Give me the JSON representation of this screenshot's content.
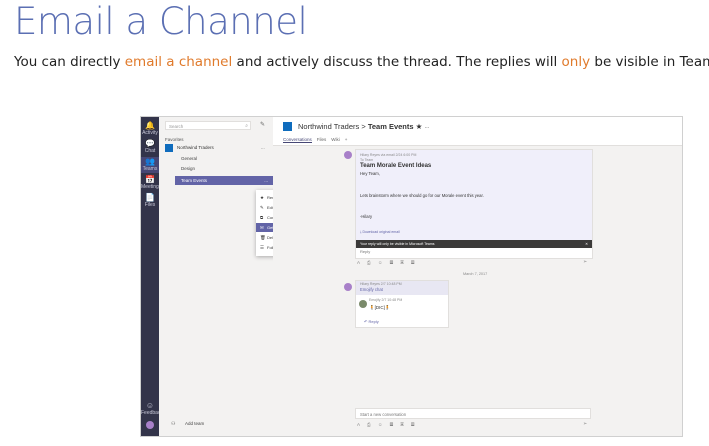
{
  "slide": {
    "title": "Email a Channel",
    "subtitle_before": "You can directly ",
    "subtitle_hl1": "email a channel",
    "subtitle_mid": " and actively discuss the thread. The replies will ",
    "subtitle_hl2": "only",
    "subtitle_after": " be visible in Teams."
  },
  "rail": {
    "items": [
      {
        "icon": "🔔",
        "label": "Activity"
      },
      {
        "icon": "💬",
        "label": "Chat"
      },
      {
        "icon": "👥",
        "label": "Teams"
      },
      {
        "icon": "📅",
        "label": "Meetings"
      },
      {
        "icon": "📄",
        "label": "Files"
      }
    ],
    "feedback": "Feedback"
  },
  "teams_panel": {
    "search_placeholder": "Search",
    "favorites_label": "Favorites",
    "team_name": "Northwind Traders",
    "team_menu": "...",
    "channels": [
      "General",
      "Design",
      "Team Events"
    ],
    "selected_menu": "...",
    "add_team": "Add team"
  },
  "context_menu": {
    "items": [
      "Remove favorite",
      "Edit this channel",
      "Connectors",
      "Get email address",
      "Delete this channel",
      "Follow this channel"
    ]
  },
  "header": {
    "team": "Northwind Traders",
    "separator": " > ",
    "channel": "Team Events",
    "star": "★",
    "more": "···",
    "tabs": [
      "Conversations",
      "Files",
      "Wiki",
      "+"
    ]
  },
  "post": {
    "meta": "Hilary Reyes via email  2/24 6:00 PM",
    "meta2": "To Team",
    "subject": "Team Morale Event Ideas",
    "greeting": "Hey Team,",
    "body": "Lets brainstorm where we should go for our Morale event this year.",
    "signature": "-Hilary",
    "download": "Download original email",
    "banner": "Your reply will only be visible in Microsoft Teams",
    "banner_close": "✕",
    "reply": "Reply"
  },
  "date_separator": "March 7, 2017",
  "chat_post": {
    "meta": "Hilary Reyes  2/7 10:48 PM",
    "text": "Emojify chat",
    "reply_meta": "Emojify  2/7 10:48 PM",
    "reply_text": "🧍[DIC]🧍",
    "reply_link": "Reply"
  },
  "compose": {
    "placeholder": "Start a new conversation"
  },
  "toolbar_icons": "A  ⎙  ☺  ▦  ▣  ▤"
}
